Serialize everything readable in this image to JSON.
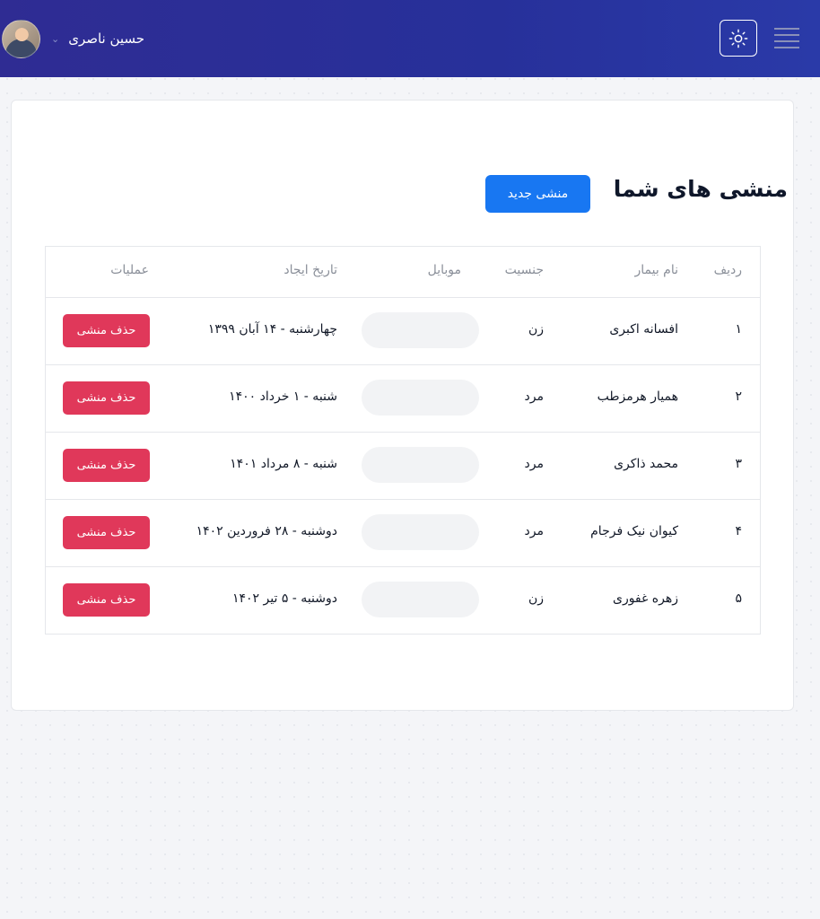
{
  "header": {
    "user_name": "حسین ناصری",
    "colors": {
      "bg_start": "#2f2c93",
      "bg_end": "#2a3aa8"
    },
    "icons": [
      "avatar",
      "chevron-down-icon",
      "sun-icon",
      "hamburger-menu-icon"
    ]
  },
  "page": {
    "title": "منشی های شما",
    "new_button": "منشی جدید"
  },
  "table": {
    "columns": {
      "index": "ردیف",
      "name": "نام بیمار",
      "gender": "جنسیت",
      "mobile": "موبایل",
      "date": "تاریخ ایجاد",
      "ops": "عملیات"
    },
    "rows": [
      {
        "index": "۱",
        "name": "افسانه اکبری",
        "gender": "زن",
        "mobile": "",
        "date": "چهارشنبه - ۱۴ آبان ۱۳۹۹",
        "action": "حذف منشی"
      },
      {
        "index": "۲",
        "name": "همیار هرمزطب",
        "gender": "مرد",
        "mobile": "",
        "date": "شنبه - ۱ خرداد ۱۴۰۰",
        "action": "حذف منشی"
      },
      {
        "index": "۳",
        "name": "محمد ذاکری",
        "gender": "مرد",
        "mobile": "",
        "date": "شنبه - ۸ مرداد ۱۴۰۱",
        "action": "حذف منشی"
      },
      {
        "index": "۴",
        "name": "کیوان نیک فرجام",
        "gender": "مرد",
        "mobile": "",
        "date": "دوشنبه - ۲۸ فروردین ۱۴۰۲",
        "action": "حذف منشی"
      },
      {
        "index": "۵",
        "name": "زهره غفوری",
        "gender": "زن",
        "mobile": "",
        "date": "دوشنبه - ۵ تیر ۱۴۰۲",
        "action": "حذف منشی"
      }
    ]
  },
  "colors": {
    "primary": "#1877f2",
    "danger": "#e0385a"
  }
}
